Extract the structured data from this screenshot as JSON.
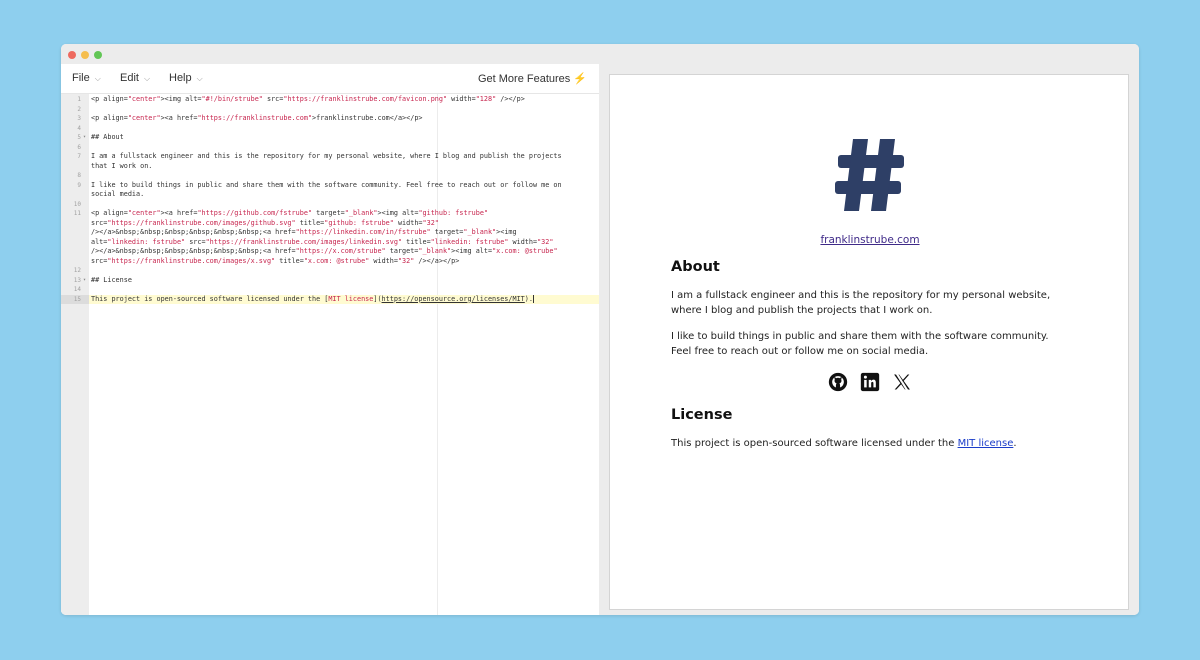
{
  "menu": {
    "file": "File",
    "edit": "Edit",
    "help": "Help",
    "features": "Get More Features",
    "features_icon": "lightning-bolt-icon"
  },
  "editor": {
    "lines": [
      {
        "n": "1",
        "segs": [
          [
            "<p align=",
            ""
          ],
          [
            "\"center\"",
            "s"
          ],
          [
            "><img alt=",
            ""
          ],
          [
            "\"#!/bin/strube\"",
            "s"
          ],
          [
            " src=",
            ""
          ],
          [
            "\"https://franklinstrube.com/favicon.png\"",
            "s"
          ],
          [
            " width=",
            ""
          ],
          [
            "\"128\"",
            "s"
          ],
          [
            " /></p>",
            ""
          ]
        ]
      },
      {
        "n": "2",
        "segs": []
      },
      {
        "n": "3",
        "segs": [
          [
            "<p align=",
            ""
          ],
          [
            "\"center\"",
            "s"
          ],
          [
            "><a href=",
            ""
          ],
          [
            "\"https://franklinstrube.com\"",
            "s"
          ],
          [
            ">franklinstrube.com</a></p>",
            ""
          ]
        ]
      },
      {
        "n": "4",
        "segs": []
      },
      {
        "n": "5",
        "fold": true,
        "segs": [
          [
            "## About",
            ""
          ]
        ]
      },
      {
        "n": "6",
        "segs": []
      },
      {
        "n": "7",
        "segs": [
          [
            "I am a fullstack engineer and this is the repository for my personal website, where I blog and publish the projects",
            ""
          ]
        ]
      },
      {
        "n": "",
        "segs": [
          [
            "that I work on.",
            ""
          ]
        ]
      },
      {
        "n": "8",
        "segs": []
      },
      {
        "n": "9",
        "segs": [
          [
            "I like to build things in public and share them with the software community. Feel free to reach out or follow me on",
            ""
          ]
        ]
      },
      {
        "n": "",
        "segs": [
          [
            "social media.",
            ""
          ]
        ]
      },
      {
        "n": "10",
        "segs": []
      },
      {
        "n": "11",
        "segs": [
          [
            "<p align=",
            ""
          ],
          [
            "\"center\"",
            "s"
          ],
          [
            "><a href=",
            ""
          ],
          [
            "\"https://github.com/fstrube\"",
            "s"
          ],
          [
            " target=",
            ""
          ],
          [
            "\"_blank\"",
            "s"
          ],
          [
            "><img alt=",
            ""
          ],
          [
            "\"github: fstrube\"",
            "s"
          ]
        ]
      },
      {
        "n": "",
        "segs": [
          [
            "src=",
            ""
          ],
          [
            "\"https://franklinstrube.com/images/github.svg\"",
            "s"
          ],
          [
            " title=",
            ""
          ],
          [
            "\"github: fstrube\"",
            "s"
          ],
          [
            " width=",
            ""
          ],
          [
            "\"32\"",
            "s"
          ]
        ]
      },
      {
        "n": "",
        "segs": [
          [
            "/></a>&nbsp;&nbsp;&nbsp;&nbsp;&nbsp;&nbsp;<a href=",
            ""
          ],
          [
            "\"https://linkedin.com/in/fstrube\"",
            "s"
          ],
          [
            " target=",
            ""
          ],
          [
            "\"_blank\"",
            "s"
          ],
          [
            "><img",
            ""
          ]
        ]
      },
      {
        "n": "",
        "segs": [
          [
            "alt=",
            ""
          ],
          [
            "\"linkedin: fstrube\"",
            "s"
          ],
          [
            " src=",
            ""
          ],
          [
            "\"https://franklinstrube.com/images/linkedin.svg\"",
            "s"
          ],
          [
            " title=",
            ""
          ],
          [
            "\"linkedin: fstrube\"",
            "s"
          ],
          [
            " width=",
            ""
          ],
          [
            "\"32\"",
            "s"
          ]
        ]
      },
      {
        "n": "",
        "segs": [
          [
            "/></a>&nbsp;&nbsp;&nbsp;&nbsp;&nbsp;&nbsp;<a href=",
            ""
          ],
          [
            "\"https://x.com/strube\"",
            "s"
          ],
          [
            " target=",
            ""
          ],
          [
            "\"_blank\"",
            "s"
          ],
          [
            "><img alt=",
            ""
          ],
          [
            "\"x.com: @strube\"",
            "s"
          ]
        ]
      },
      {
        "n": "",
        "segs": [
          [
            "src=",
            ""
          ],
          [
            "\"https://franklinstrube.com/images/x.svg\"",
            "s"
          ],
          [
            " title=",
            ""
          ],
          [
            "\"x.com: @strube\"",
            "s"
          ],
          [
            " width=",
            ""
          ],
          [
            "\"32\"",
            "s"
          ],
          [
            " /></a></p>",
            ""
          ]
        ]
      },
      {
        "n": "12",
        "segs": []
      },
      {
        "n": "13",
        "fold": true,
        "segs": [
          [
            "## License",
            ""
          ]
        ]
      },
      {
        "n": "14",
        "segs": []
      },
      {
        "n": "15",
        "active": true,
        "segs": [
          [
            "This project is open-sourced software licensed under the [",
            ""
          ],
          [
            "MIT license",
            "s"
          ],
          [
            "](",
            ""
          ],
          [
            "https://opensource.org/licenses/MIT",
            "u"
          ],
          [
            ").",
            ""
          ]
        ]
      }
    ]
  },
  "preview": {
    "logo_icon": "hash-logo-icon",
    "site_link": "franklinstrube.com",
    "about_heading": "About",
    "about_p1": "I am a fullstack engineer and this is the repository for my personal website, where I blog and publish the projects that I work on.",
    "about_p2": "I like to build things in public and share them with the software community. Feel free to reach out or follow me on social media.",
    "social": [
      "github-icon",
      "linkedin-icon",
      "x-icon"
    ],
    "license_heading": "License",
    "license_text": "This project is open-sourced software licensed under the ",
    "license_link": "MIT license",
    "license_end": "."
  },
  "colors": {
    "background": "#8ecfee",
    "logo": "#2e3f66",
    "link": "#1a3cc9",
    "string": "#c7254e",
    "active_line": "#fffbd1"
  }
}
